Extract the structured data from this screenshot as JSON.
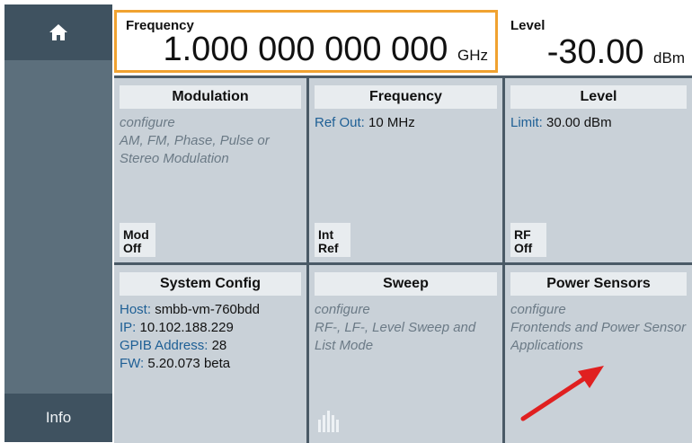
{
  "sidebar": {
    "home_icon": "home-icon",
    "info_label": "Info"
  },
  "status": {
    "frequency": {
      "label": "Frequency",
      "value": "1.000 000 000 000",
      "unit": "GHz"
    },
    "level": {
      "label": "Level",
      "value": "-30.00",
      "unit": "dBm"
    }
  },
  "tiles": {
    "modulation": {
      "title": "Modulation",
      "line1": "configure",
      "line2": "AM, FM, Phase, Pulse or",
      "line3": "Stereo Modulation",
      "badge_line1": "Mod",
      "badge_line2": "Off"
    },
    "frequency": {
      "title": "Frequency",
      "ref_out_key": "Ref Out:",
      "ref_out_value": "10 MHz",
      "badge_line1": "Int",
      "badge_line2": "Ref"
    },
    "level": {
      "title": "Level",
      "limit_key": "Limit:",
      "limit_value": "30.00 dBm",
      "badge_line1": "RF",
      "badge_line2": "Off"
    },
    "system_config": {
      "title": "System Config",
      "host_key": "Host:",
      "host_value": "smbb-vm-760bdd",
      "ip_key": "IP:",
      "ip_value": "10.102.188.229",
      "gpib_key": "GPIB Address:",
      "gpib_value": "28",
      "fw_key": "FW:",
      "fw_value": "5.20.073 beta"
    },
    "sweep": {
      "title": "Sweep",
      "line1": "configure",
      "line2": "RF-, LF-, Level Sweep and",
      "line3": "List Mode",
      "icon": "sweep-icon"
    },
    "power_sensors": {
      "title": "Power Sensors",
      "line1": "configure",
      "line2": "Frontends and Power Sensor",
      "line3": "Applications"
    }
  },
  "annotation": {
    "color": "#e02020",
    "icon": "arrow-icon"
  }
}
